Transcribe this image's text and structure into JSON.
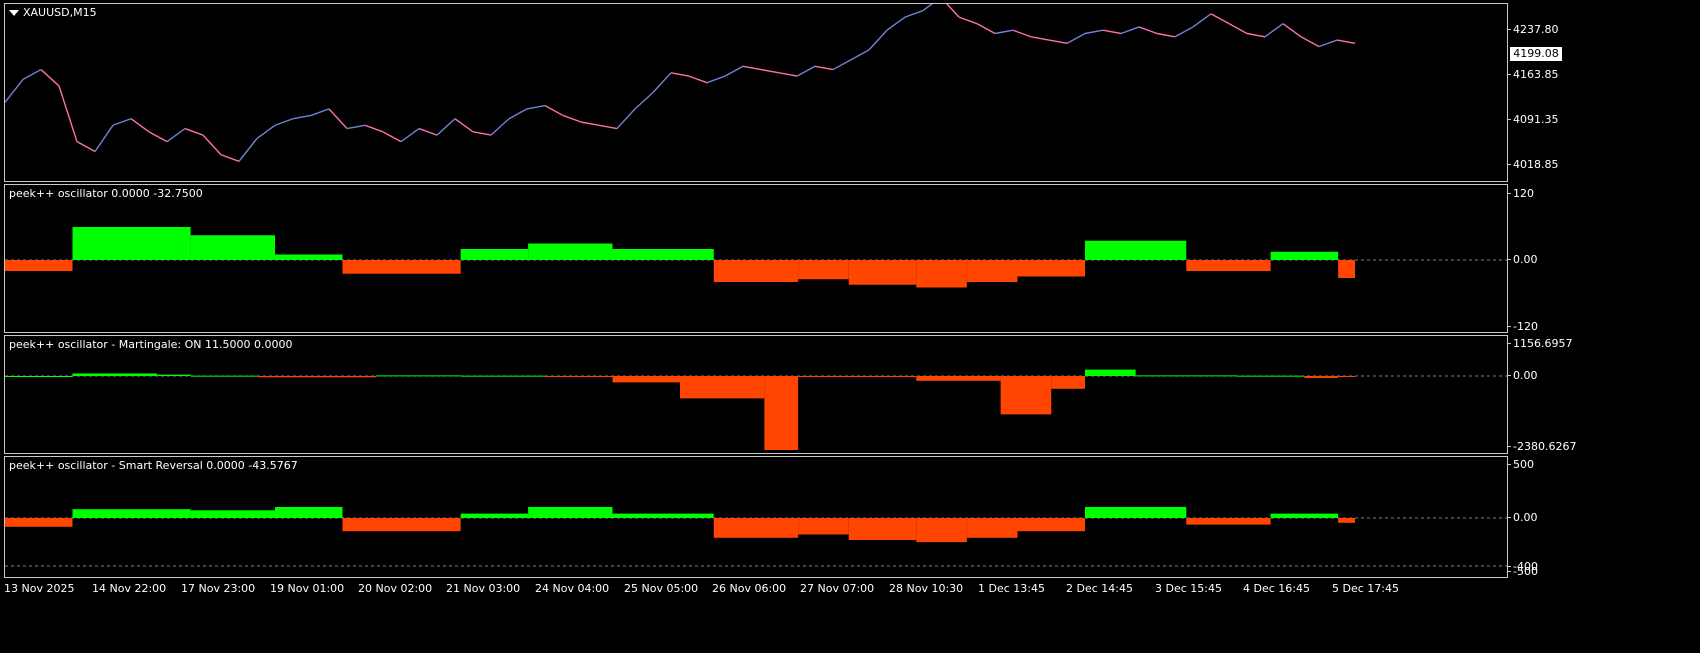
{
  "chart": {
    "symbol": "XAUUSD,M15",
    "current_price": "4199.08",
    "price_ticks": [
      "4237.80",
      "4163.85",
      "4091.35",
      "4018.85"
    ],
    "colors": {
      "positive": "#00ff00",
      "negative": "#ff4500",
      "price_up": "#6f84d6",
      "price_down": "#ff6fb0"
    }
  },
  "panels": [
    {
      "label": "peek++ oscillator 0.0000 -32.7500",
      "ticks": [
        "120",
        "0.00",
        "-120"
      ]
    },
    {
      "label": "peek++ oscillator - Martingale: ON 11.5000 0.0000",
      "ticks": [
        "1156.6957",
        "0.00",
        "-2380.6267"
      ]
    },
    {
      "label": "peek++ oscillator - Smart Reversal 0.0000 -43.5767",
      "ticks": [
        "500",
        "0.00",
        "-400",
        "-500"
      ]
    }
  ],
  "time_axis": [
    "13 Nov 2025",
    "14 Nov 22:00",
    "17 Nov 23:00",
    "19 Nov 01:00",
    "20 Nov 02:00",
    "21 Nov 03:00",
    "24 Nov 04:00",
    "25 Nov 05:00",
    "26 Nov 06:00",
    "27 Nov 07:00",
    "28 Nov 10:30",
    "1 Dec 13:45",
    "2 Dec 14:45",
    "3 Dec 15:45",
    "4 Dec 16:45",
    "5 Dec 17:45"
  ],
  "chart_data": {
    "type": "line",
    "price_series": [
      4120,
      4155,
      4170,
      4145,
      4060,
      4045,
      4085,
      4095,
      4075,
      4060,
      4080,
      4070,
      4040,
      4030,
      4065,
      4085,
      4095,
      4100,
      4110,
      4080,
      4085,
      4075,
      4060,
      4080,
      4070,
      4095,
      4075,
      4070,
      4095,
      4110,
      4115,
      4100,
      4090,
      4085,
      4080,
      4110,
      4135,
      4165,
      4160,
      4150,
      4160,
      4175,
      4170,
      4165,
      4160,
      4175,
      4170,
      4185,
      4200,
      4230,
      4250,
      4260,
      4280,
      4250,
      4240,
      4225,
      4230,
      4220,
      4215,
      4210,
      4225,
      4230,
      4225,
      4235,
      4225,
      4220,
      4235,
      4255,
      4240,
      4225,
      4220,
      4240,
      4220,
      4205,
      4215,
      4210
    ],
    "osc1_segments": [
      [
        0,
        -20
      ],
      [
        4,
        60
      ],
      [
        11,
        45
      ],
      [
        16,
        10
      ],
      [
        20,
        -25
      ],
      [
        27,
        20
      ],
      [
        31,
        30
      ],
      [
        36,
        20
      ],
      [
        42,
        -40
      ],
      [
        47,
        -35
      ],
      [
        50,
        -45
      ],
      [
        54,
        -50
      ],
      [
        57,
        -40
      ],
      [
        60,
        -30
      ],
      [
        64,
        35
      ],
      [
        70,
        -20
      ],
      [
        75,
        15
      ],
      [
        79,
        -32.75
      ]
    ],
    "martingale_segments": [
      [
        0,
        0
      ],
      [
        4,
        80
      ],
      [
        9,
        40
      ],
      [
        11,
        10
      ],
      [
        15,
        -40
      ],
      [
        22,
        20
      ],
      [
        27,
        10
      ],
      [
        32,
        -10
      ],
      [
        36,
        -200
      ],
      [
        40,
        -700
      ],
      [
        45,
        -2380
      ],
      [
        47,
        -20
      ],
      [
        54,
        -150
      ],
      [
        59,
        -1200
      ],
      [
        62,
        -400
      ],
      [
        64,
        200
      ],
      [
        67,
        20
      ],
      [
        73,
        10
      ],
      [
        77,
        -60
      ],
      [
        79,
        -20
      ]
    ],
    "reversal_segments": [
      [
        0,
        -80
      ],
      [
        4,
        80
      ],
      [
        11,
        70
      ],
      [
        16,
        100
      ],
      [
        20,
        -120
      ],
      [
        27,
        40
      ],
      [
        31,
        100
      ],
      [
        36,
        40
      ],
      [
        42,
        -180
      ],
      [
        47,
        -150
      ],
      [
        50,
        -200
      ],
      [
        54,
        -220
      ],
      [
        57,
        -180
      ],
      [
        60,
        -120
      ],
      [
        64,
        100
      ],
      [
        70,
        -60
      ],
      [
        75,
        40
      ],
      [
        79,
        -43.58
      ]
    ]
  }
}
